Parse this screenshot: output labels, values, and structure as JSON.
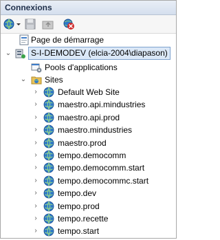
{
  "panel": {
    "title": "Connexions"
  },
  "toolbar": {
    "buttons": [
      {
        "name": "connect",
        "icon": "globe-connect-icon"
      },
      {
        "name": "save",
        "icon": "save-icon"
      },
      {
        "name": "up",
        "icon": "folder-up-icon"
      },
      {
        "name": "disconnect",
        "icon": "disconnect-icon"
      }
    ]
  },
  "tree": {
    "start_page": "Page de démarrage",
    "server": "S-I-DEMODEV (elcia-2004\\diapason)",
    "app_pools": "Pools d'applications",
    "sites": "Sites",
    "site_items": [
      "Default Web Site",
      "maestro.api.mindustries",
      "maestro.api.prod",
      "maestro.mindustries",
      "maestro.prod",
      "tempo.democomm",
      "tempo.democomm.start",
      "tempo.democommc.start",
      "tempo.dev",
      "tempo.prod",
      "tempo.recette",
      "tempo.start"
    ]
  }
}
